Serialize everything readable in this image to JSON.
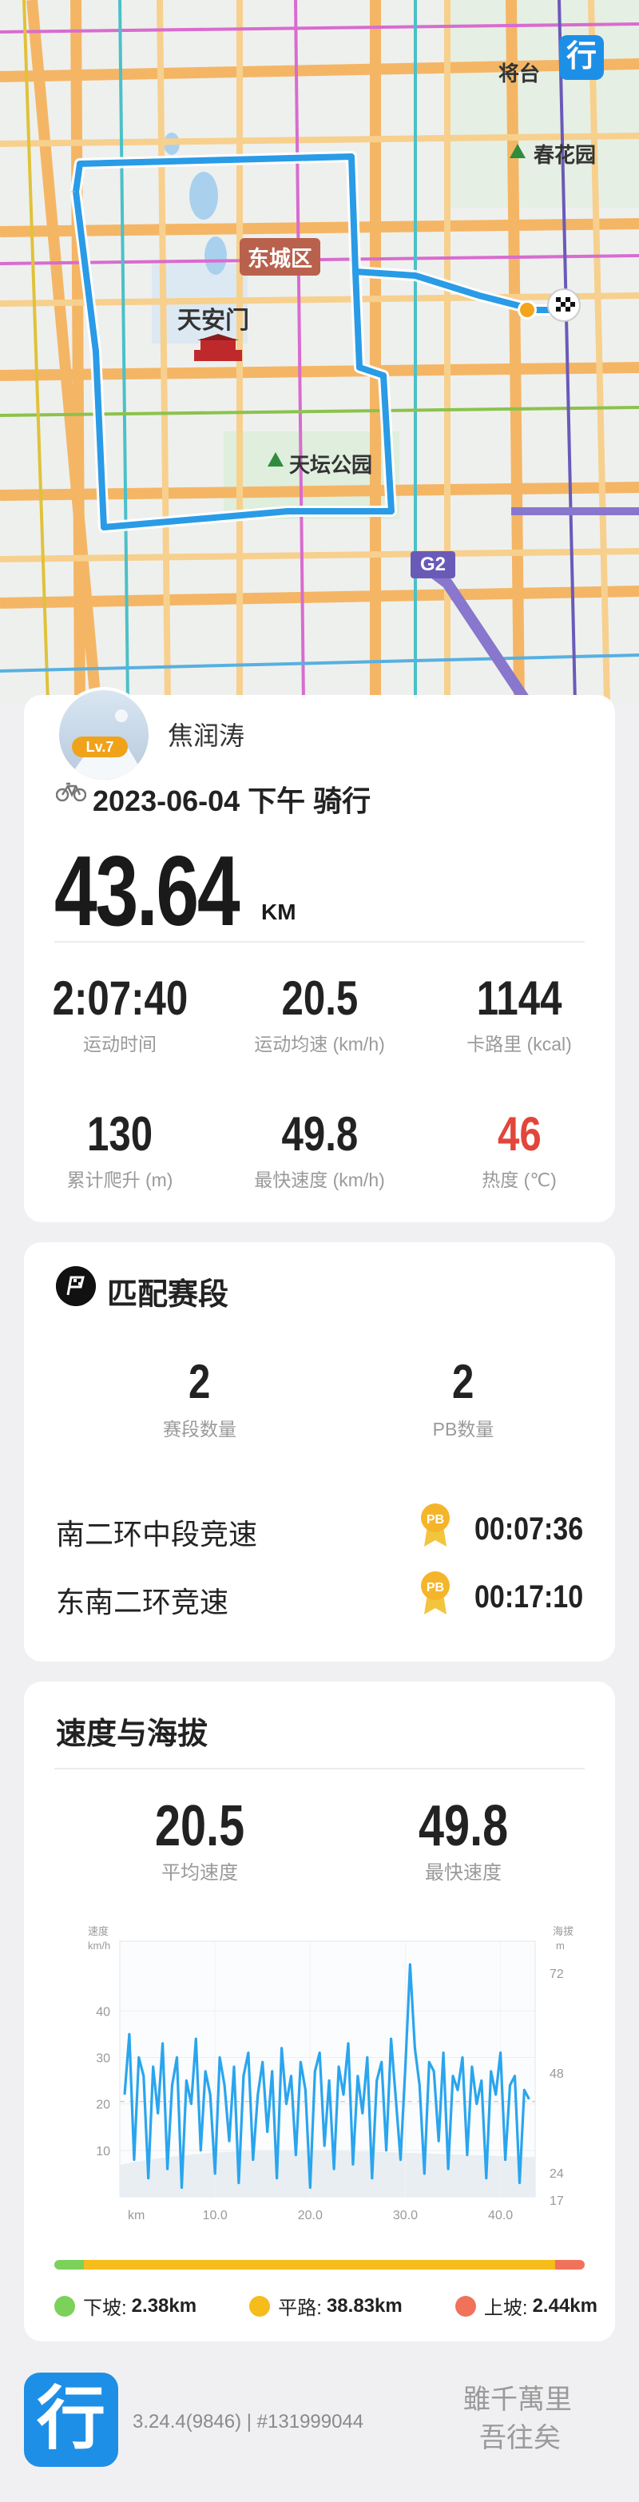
{
  "map": {
    "labels": {
      "jiangtai": "将台",
      "chunhuayuan": "春花园",
      "tiananmen": "天安门",
      "tiantan": "天坛公园"
    },
    "district_badge": "东城区",
    "highway_shield": "G2",
    "app_logo_glyph": "行",
    "colors": {
      "route": "#2a9be6",
      "finish_flag": "#111111"
    }
  },
  "summary": {
    "user_name": "焦润涛",
    "level": "Lv.7",
    "ride_title": "2023-06-04 下午 骑行",
    "distance": "43.64",
    "distance_unit": "KM",
    "stats": [
      {
        "value": "2:07:40",
        "label": "运动时间"
      },
      {
        "value": "20.5",
        "label": "运动均速 (km/h)"
      },
      {
        "value": "1144",
        "label": "卡路里 (kcal)"
      },
      {
        "value": "130",
        "label": "累计爬升 (m)"
      },
      {
        "value": "49.8",
        "label": "最快速度 (km/h)"
      },
      {
        "value": "46",
        "label": "热度 (℃)",
        "color": "#e2463a"
      }
    ]
  },
  "segments": {
    "title": "匹配赛段",
    "count": {
      "value": "2",
      "label": "赛段数量"
    },
    "pb": {
      "value": "2",
      "label": "PB数量"
    },
    "badge_text": "PB",
    "rows": [
      {
        "name": "南二环中段竞速",
        "time": "00:07:36"
      },
      {
        "name": "东南二环竞速",
        "time": "00:17:10"
      }
    ]
  },
  "speed": {
    "title": "速度与海拔",
    "avg": {
      "value": "20.5",
      "label": "平均速度"
    },
    "max": {
      "value": "49.8",
      "label": "最快速度"
    },
    "legend": [
      {
        "label": "下坡:",
        "value": "2.38km",
        "color": "#7bd15a",
        "fraction": 0.055
      },
      {
        "label": "平路:",
        "value": "38.83km",
        "color": "#f5bc1c",
        "fraction": 0.89
      },
      {
        "label": "上坡:",
        "value": "2.44km",
        "color": "#f0725a",
        "fraction": 0.055
      }
    ]
  },
  "chart_data": {
    "type": "line",
    "title": "",
    "left_axis_title": "速度",
    "left_axis_unit": "km/h",
    "right_axis_title": "海拔",
    "right_axis_unit": "m",
    "xlabel": "km",
    "x_ticks": [
      "10.0",
      "20.0",
      "30.0",
      "40.0"
    ],
    "y_ticks": [
      "10",
      "20",
      "30",
      "40"
    ],
    "y2_ticks": [
      "24",
      "48",
      "72"
    ],
    "y2_min_label": "17",
    "xlim": [
      0,
      43.64
    ],
    "ylim": [
      0,
      55
    ],
    "series": [
      {
        "color": "#2aa5ee",
        "x": [
          0.5,
          1,
          1.5,
          2,
          2.5,
          3,
          3.5,
          4,
          4.5,
          5,
          5.5,
          6,
          6.5,
          7,
          7.5,
          8,
          8.5,
          9,
          9.5,
          10,
          10.5,
          11,
          11.5,
          12,
          12.5,
          13,
          13.5,
          14,
          14.5,
          15,
          15.5,
          16,
          16.5,
          17,
          17.5,
          18,
          18.5,
          19,
          19.5,
          20,
          20.5,
          21,
          21.5,
          22,
          22.5,
          23,
          23.5,
          24,
          24.5,
          25,
          25.5,
          26,
          26.5,
          27,
          27.5,
          28,
          28.5,
          29,
          29.5,
          30,
          30.5,
          31,
          31.5,
          32,
          32.5,
          33,
          33.5,
          34,
          34.5,
          35,
          35.5,
          36,
          36.5,
          37,
          37.5,
          38,
          38.5,
          39,
          39.5,
          40,
          40.5,
          41,
          41.5,
          42,
          42.5,
          43
        ],
        "y": [
          22,
          35,
          8,
          30,
          26,
          4,
          28,
          18,
          33,
          6,
          24,
          30,
          2,
          25,
          20,
          34,
          10,
          27,
          22,
          5,
          30,
          24,
          12,
          28,
          3,
          26,
          31,
          8,
          22,
          29,
          14,
          27,
          4,
          32,
          20,
          26,
          9,
          29,
          23,
          2,
          27,
          31,
          11,
          25,
          6,
          28,
          22,
          33,
          7,
          26,
          18,
          30,
          4,
          25,
          29,
          10,
          34,
          21,
          8,
          28,
          50,
          32,
          24,
          5,
          29,
          27,
          12,
          31,
          6,
          26,
          23,
          30,
          9,
          28,
          20,
          25,
          4,
          27,
          22,
          31,
          8,
          24,
          26,
          3,
          23,
          21
        ]
      }
    ]
  },
  "footer": {
    "logo_glyph": "行",
    "version": "3.24.4(9846) | #131999044",
    "slogan_line1": "雖千萬里",
    "slogan_line2": "吾往矣"
  }
}
